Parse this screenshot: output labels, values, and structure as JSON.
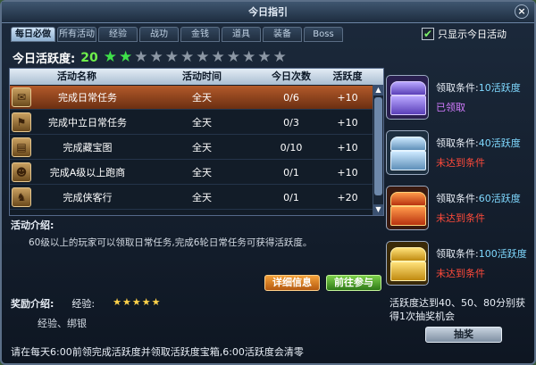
{
  "window": {
    "title": "今日指引",
    "close_glyph": "×"
  },
  "tabs": [
    "每日必做",
    "所有活动",
    "经验",
    "战功",
    "金钱",
    "道具",
    "装备",
    "Boss"
  ],
  "filter": {
    "checked_glyph": "✔",
    "label": "只显示今日活动"
  },
  "activity": {
    "label": "今日活跃度:",
    "value": "20",
    "stars_total": 12,
    "stars_filled": 2
  },
  "table": {
    "headers": [
      "活动名称",
      "活动时间",
      "今日次数",
      "活跃度"
    ],
    "rows": [
      {
        "name": "完成日常任务",
        "time": "全天",
        "count": "0/6",
        "points": "+10"
      },
      {
        "name": "完成中立日常任务",
        "time": "全天",
        "count": "0/3",
        "points": "+10"
      },
      {
        "name": "完成藏宝图",
        "time": "全天",
        "count": "0/10",
        "points": "+10"
      },
      {
        "name": "完成A级以上跑商",
        "time": "全天",
        "count": "0/1",
        "points": "+10"
      },
      {
        "name": "完成侠客行",
        "time": "全天",
        "count": "0/1",
        "points": "+20"
      }
    ]
  },
  "intro": {
    "label": "活动介绍:",
    "text": "60级以上的玩家可以领取日常任务,完成6轮日常任务可获得活跃度。"
  },
  "buttons": {
    "detail": "详细信息",
    "go": "前往参与",
    "lottery": "抽奖"
  },
  "reward": {
    "label": "奖励介绍:",
    "exp_label": "经验:",
    "stars": "★★★★★",
    "items": "经验、绑银"
  },
  "chests": [
    {
      "cond_prefix": "领取条件:",
      "cond_value": "10活跃度",
      "status": "已领取",
      "status_color": "#d27bff"
    },
    {
      "cond_prefix": "领取条件:",
      "cond_value": "40活跃度",
      "status": "未达到条件",
      "status_color": "#ff4a3a"
    },
    {
      "cond_prefix": "领取条件:",
      "cond_value": "60活跃度",
      "status": "未达到条件",
      "status_color": "#ff4a3a"
    },
    {
      "cond_prefix": "领取条件:",
      "cond_value": "100活跃度",
      "status": "未达到条件",
      "status_color": "#ff4a3a"
    }
  ],
  "lottery_note": "活跃度达到40、50、80分别获得1次抽奖机会",
  "footer": "请在每天6:00前领完成活跃度并领取活跃度宝箱,6:00活跃度会清零"
}
